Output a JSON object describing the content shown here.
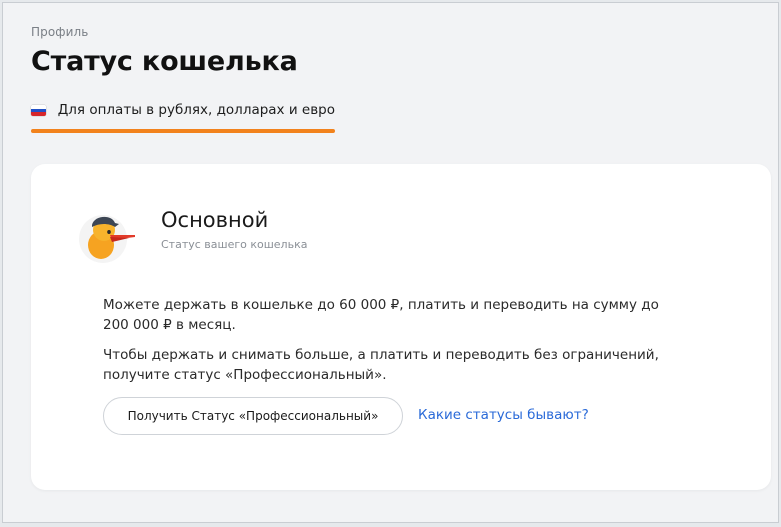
{
  "breadcrumb": "Профиль",
  "page_title": "Статус кошелька",
  "tab": {
    "label": "Для оплаты в рублях, долларах и евро",
    "flag_icon": "russia-flag-icon",
    "accent_color": "#f2821c"
  },
  "status_card": {
    "avatar_icon": "duck-mascot-icon",
    "status_name": "Основной",
    "status_subtitle": "Статус вашего кошелька",
    "description_1": "Можете держать в кошельке до 60 000 ₽, платить и переводить на сумму до 200 000 ₽ в месяц.",
    "description_2": "Чтобы держать и снимать больше, а платить и переводить без ограничений, получите статус «Профессиональный».",
    "pro_button_label": "Получить Статус «Профессиональный»",
    "statuses_link_label": "Какие статусы бывают?",
    "link_color": "#2a6ad8"
  }
}
